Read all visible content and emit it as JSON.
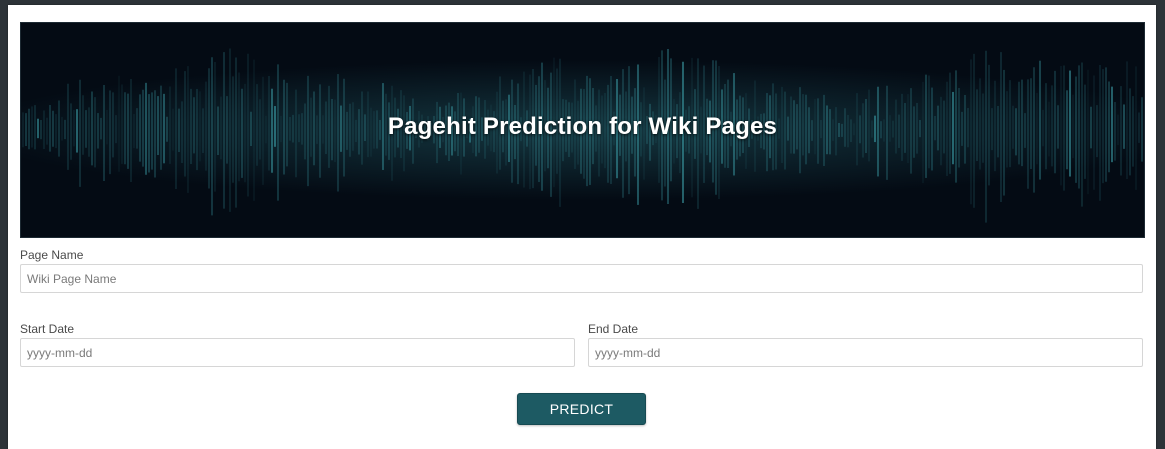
{
  "banner": {
    "title": "Pagehit Prediction for Wiki Pages"
  },
  "form": {
    "page_name": {
      "label": "Page Name",
      "placeholder": "Wiki Page Name",
      "value": ""
    },
    "start_date": {
      "label": "Start Date",
      "placeholder": "yyyy-mm-dd",
      "value": ""
    },
    "end_date": {
      "label": "End Date",
      "placeholder": "yyyy-mm-dd",
      "value": ""
    },
    "submit_label": "PREDICT"
  },
  "colors": {
    "banner_background": "#040b14",
    "waveform": "#3fa6b0",
    "button": "#1d5a63"
  }
}
